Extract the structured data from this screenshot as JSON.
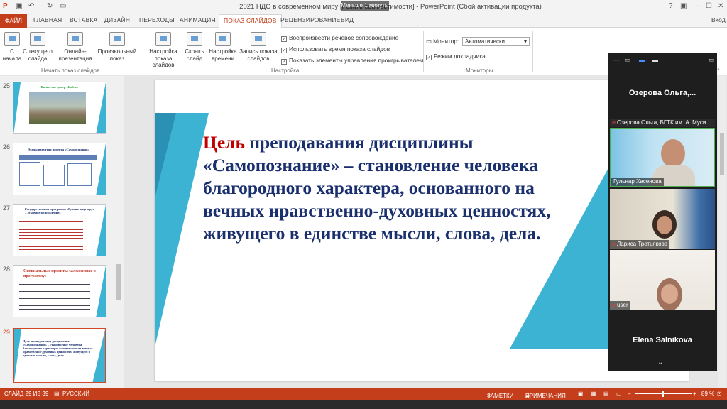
{
  "window": {
    "title": "2021 НДО в современном миру [Режим совместимости] - PowerPoint (Сбой активации продукта)",
    "overlay_text": "Меньше 1 минуты",
    "help": "?",
    "minimize": "—",
    "maximize": "☐",
    "close": "✕"
  },
  "tabs": {
    "file": "ФАЙЛ",
    "items": [
      "ГЛАВНАЯ",
      "ВСТАВКА",
      "ДИЗАЙН",
      "ПЕРЕХОДЫ",
      "АНИМАЦИЯ",
      "ПОКАЗ СЛАЙДОВ",
      "РЕЦЕНЗИРОВАНИЕ",
      "ВИД"
    ],
    "active": "ПОКАЗ СЛАЙДОВ",
    "sign_in": "Вход"
  },
  "ribbon": {
    "start": {
      "from_beginning": "С начала",
      "from_current": "С текущего слайда",
      "online": "Онлайн-презентация",
      "custom": "Произвольный показ",
      "group_label": "Начать показ слайдов"
    },
    "setup": {
      "setup_show": "Настройка показа слайдов",
      "hide_slide": "Скрыть слайд",
      "rehearse": "Настройка времени",
      "record": "Запись показа слайдов",
      "group_label": "Настройка",
      "checks": [
        {
          "label": "Воспроизвести речевое сопровождение",
          "checked": true
        },
        {
          "label": "Использовать время показа слайдов",
          "checked": true
        },
        {
          "label": "Показать элементы управления проигрывателем",
          "checked": true
        }
      ]
    },
    "monitors": {
      "monitor_label": "Монитор:",
      "monitor_value": "Автоматически",
      "presenter_view": "Режим докладчика",
      "presenter_checked": true,
      "group_label": "Мониторы"
    }
  },
  "thumbnails": [
    {
      "num": "25",
      "title": "Фильм нас центр «Бобек»"
    },
    {
      "num": "26",
      "title": "Этапы развития проекта «Самопознание»"
    },
    {
      "num": "27",
      "title": "Государственная программа «Рухани жаңғыру» – духовное возрождение»"
    },
    {
      "num": "28",
      "title": "Специальные проекты заложенные в программу:"
    },
    {
      "num": "29",
      "title": "Цель преподавания дисциплины «Самопознание» – становление человека благородного характера, основанного на вечных нравственно-духовных ценностях, живущего в единстве мысли, слова, дела."
    }
  ],
  "slide": {
    "accent": "Цель",
    "body": " преподавания дисциплины «Самопознание» – становление человека благородного характера, основанного на вечных нравственно-духовных ценностях, живущего в единстве мысли, слова, дела."
  },
  "video": {
    "top_participant": "Озерова  Ольга,...",
    "tiles": [
      {
        "label": "Озерова Ольга, БГТК им. А. Муси..."
      },
      {
        "label": "Гульнар Хасенова"
      },
      {
        "label": "Лариса Третьякова"
      },
      {
        "label": "user"
      }
    ],
    "bottom_participant": "Elena Salnikova",
    "more": "⌄"
  },
  "status": {
    "slide_of": "СЛАЙД 29 ИЗ 39",
    "language": "РУССКИЙ",
    "notes": "ЗАМЕТКИ",
    "comments": "ПРИМЕЧАНИЯ",
    "zoom": "89 %"
  },
  "colors": {
    "accent_red": "#c43e1c",
    "slide_teal": "#3db3d3",
    "slide_text": "#1a2f6e"
  }
}
